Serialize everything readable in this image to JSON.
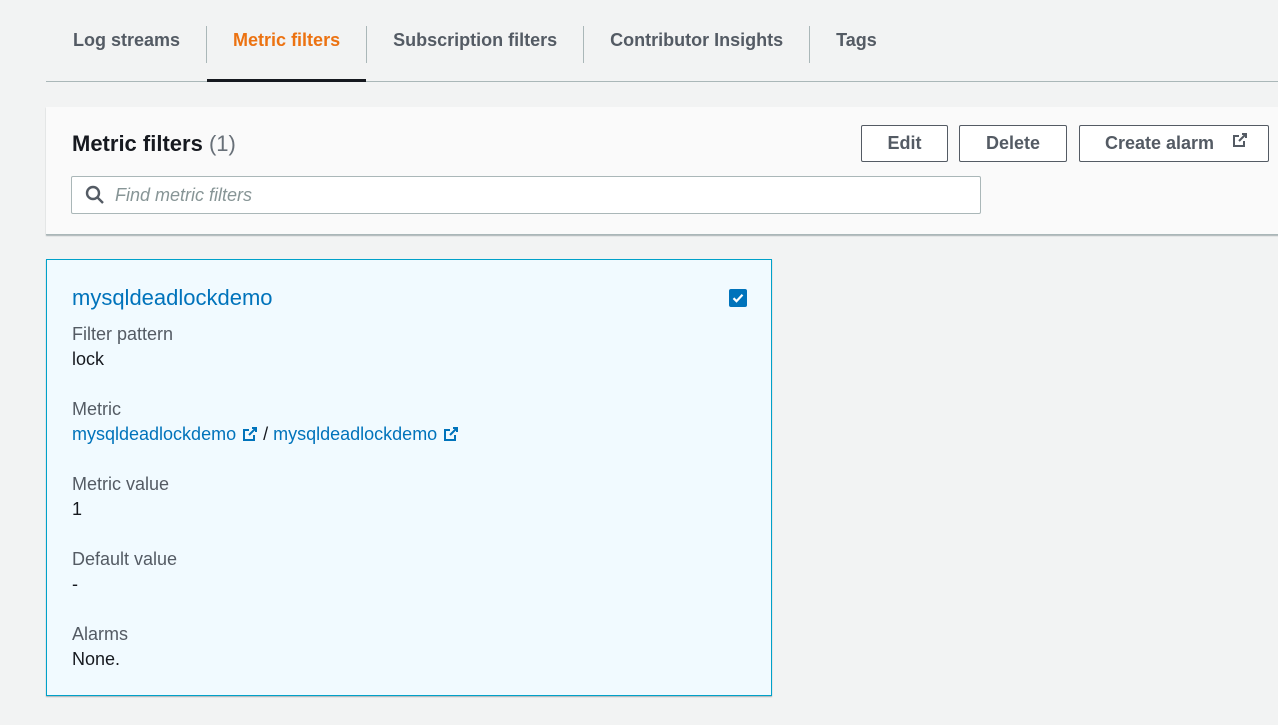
{
  "tabs": [
    {
      "label": "Log streams"
    },
    {
      "label": "Metric filters",
      "active": true
    },
    {
      "label": "Subscription filters"
    },
    {
      "label": "Contributor Insights"
    },
    {
      "label": "Tags"
    }
  ],
  "panel": {
    "title": "Metric filters",
    "count": "(1)",
    "buttons": {
      "edit": "Edit",
      "delete": "Delete",
      "create_alarm": "Create alarm"
    },
    "search": {
      "placeholder": "Find metric filters",
      "value": ""
    }
  },
  "card": {
    "title": "mysqldeadlockdemo",
    "checked": true,
    "filter_pattern": {
      "label": "Filter pattern",
      "value": "lock"
    },
    "metric": {
      "label": "Metric",
      "namespace": "mysqldeadlockdemo",
      "separator": "/",
      "name": "mysqldeadlockdemo"
    },
    "metric_value": {
      "label": "Metric value",
      "value": "1"
    },
    "default_value": {
      "label": "Default value",
      "value": "-"
    },
    "alarms": {
      "label": "Alarms",
      "value": "None."
    }
  },
  "colors": {
    "accent_orange": "#ec7211",
    "link_blue": "#0073bb",
    "card_border": "#00a1c9",
    "card_bg": "#f1faff"
  }
}
